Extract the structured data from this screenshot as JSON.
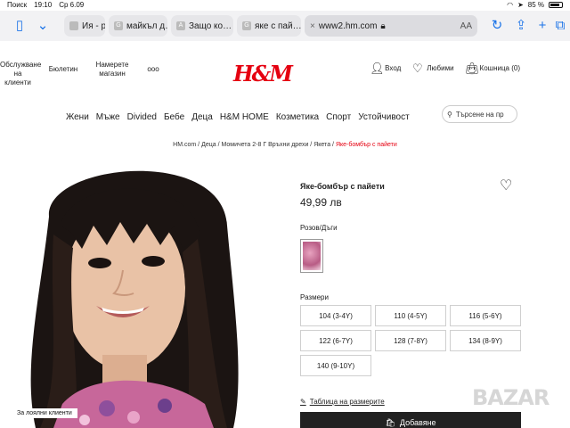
{
  "status": {
    "back": "Поиск",
    "time": "19:10",
    "date": "Ср 6.09",
    "battery": "85 %",
    "battery_level": 0.85
  },
  "tabs": [
    {
      "label": "Ия - ро…",
      "fav": ""
    },
    {
      "label": "майкъл д…",
      "fav": "G"
    },
    {
      "label": "Защо ко…",
      "fav": "A"
    },
    {
      "label": "яке с пай…",
      "fav": "G"
    },
    {
      "label": "www2.hm.com",
      "fav": "×",
      "aa": "AA"
    }
  ],
  "header": {
    "util_left": [
      "Обслужване на клиенти",
      "Бюлетин",
      "Намерете магазин"
    ],
    "util_more": "ooo",
    "logo": "H&M",
    "login": "Вход",
    "favorites": "Любими",
    "cart": "Кошница (0)"
  },
  "nav": [
    "Жени",
    "Мъже",
    "Divided",
    "Бебе",
    "Деца",
    "H&M HOME",
    "Козметика",
    "Спорт",
    "Устойчивост"
  ],
  "search": {
    "placeholder": "Търсене на пр"
  },
  "breadcrumb": [
    "HM.com",
    "Деца",
    "Момичета 2-8 Г Връхни дрехи",
    "Якета"
  ],
  "breadcrumb_current": "Яке-бомбър с пайети",
  "product": {
    "title": "Яке-бомбър с пайети",
    "price": "49,99 лв",
    "color_label": "Розов/Дъги",
    "sizes_label": "Размери",
    "sizes": [
      "104 (3-4Y)",
      "110 (4-5Y)",
      "116 (5-6Y)",
      "122 (6-7Y)",
      "128 (7-8Y)",
      "134 (8-9Y)",
      "140 (9-10Y)"
    ],
    "size_guide": "Таблица на размерите",
    "add_button": "Добавяне"
  },
  "photo_badge": "За лоялни клиенти",
  "watermark": "BAZAR",
  "colors": {
    "brand": "#e50010",
    "button": "#222222"
  }
}
